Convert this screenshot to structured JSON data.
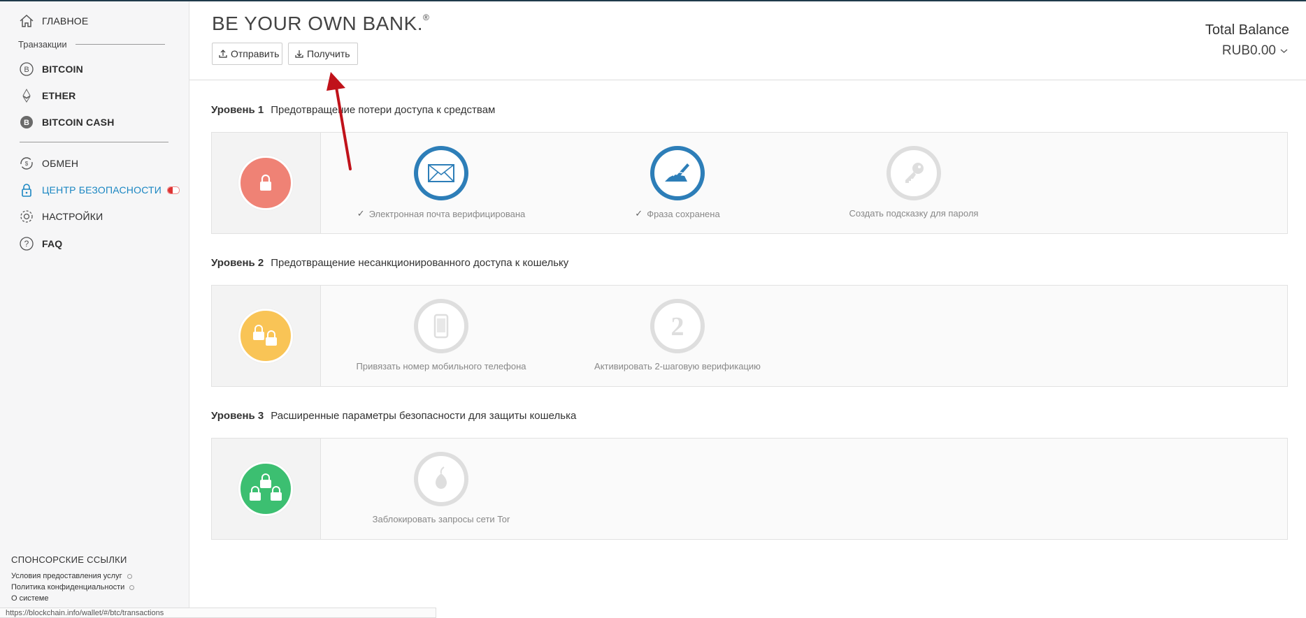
{
  "sidebar": {
    "home_label": "ГЛАВНОЕ",
    "transactions_label": "Транзакции",
    "items": [
      {
        "label": "BITCOIN"
      },
      {
        "label": "ETHER"
      },
      {
        "label": "BITCOIN CASH"
      },
      {
        "label": "ОБМЕН"
      },
      {
        "label": "ЦЕНТР БЕЗОПАСНОСТИ"
      },
      {
        "label": "НАСТРОЙКИ"
      },
      {
        "label": "FAQ"
      }
    ],
    "sponsor_title": "СПОНСОРСКИЕ ССЫЛКИ",
    "footer_links": [
      "Условия предоставления услуг",
      "Политика конфиденциальности",
      "О системе"
    ]
  },
  "statusbar": {
    "url": "https://blockchain.info/wallet/#/btc/transactions"
  },
  "header": {
    "brand": "BE YOUR OWN BANK.",
    "brand_mark": "®",
    "send_label": "Отправить",
    "receive_label": "Получить",
    "total_label": "Total Balance",
    "total_value": "RUB0.00"
  },
  "levels": [
    {
      "num": "Уровень 1",
      "title": "Предотвращение потери доступа к средствам",
      "items": [
        {
          "label": "Электронная почта верифицирована",
          "done": true,
          "check": "✓"
        },
        {
          "label": "Фраза сохранена",
          "done": true,
          "check": "✓"
        },
        {
          "label": "Создать подсказку для пароля",
          "done": false
        }
      ]
    },
    {
      "num": "Уровень 2",
      "title": "Предотвращение несанкционированного доступа к кошельку",
      "items": [
        {
          "label": "Привязать номер мобильного телефона",
          "done": false
        },
        {
          "label": "Активировать 2-шаговую верификацию",
          "done": false
        }
      ]
    },
    {
      "num": "Уровень 3",
      "title": "Расширенные параметры безопасности для защиты кошелька",
      "items": [
        {
          "label": "Заблокировать запросы сети Tor",
          "done": false
        }
      ]
    }
  ],
  "colors": {
    "accent": "#1a86c2",
    "level1": "#ef8275",
    "level2": "#f9c456",
    "level3": "#3cbf71",
    "done_ring": "#2d7eb8",
    "annotation": "#c0121a"
  }
}
